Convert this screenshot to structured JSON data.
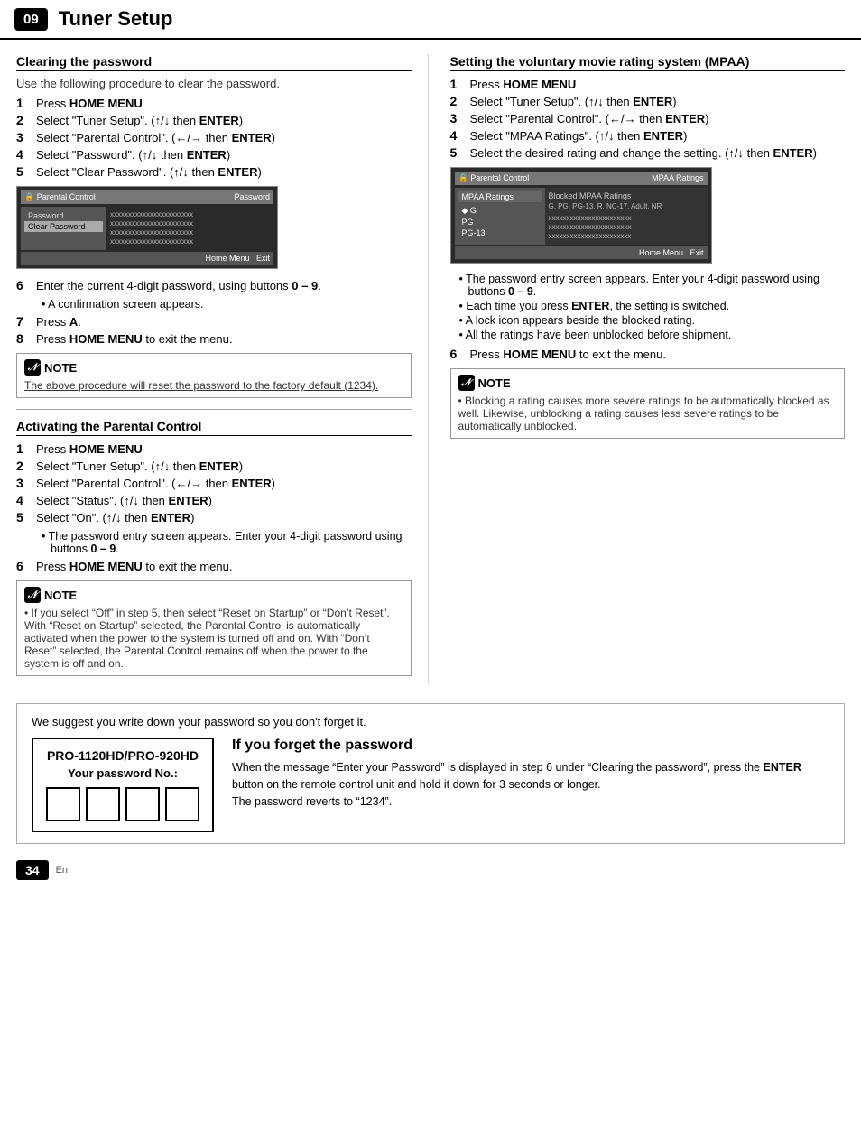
{
  "header": {
    "chapter": "09",
    "title": "Tuner Setup"
  },
  "left_column": {
    "section1": {
      "title": "Clearing the password",
      "subtitle": "Use the following procedure to clear the password.",
      "steps": [
        {
          "num": "1",
          "text": "Press ",
          "bold": "HOME MENU",
          "after": ""
        },
        {
          "num": "2",
          "text": "Select “Tuner Setup”. (",
          "arrow": "↑/↓",
          "then": " then ",
          "bold2": "ENTER",
          "after": ")"
        },
        {
          "num": "3",
          "text": "Select “Parental Control”. (",
          "arrow": "←/→",
          "then": " then ",
          "bold2": "ENTER",
          "after": ")"
        },
        {
          "num": "4",
          "text": "Select “Password”. (",
          "arrow": "↑/↓",
          "then": " then ",
          "bold2": "ENTER",
          "after": ")"
        },
        {
          "num": "5",
          "text": "Select “Clear Password”. (",
          "arrow": "↑/↓",
          "then": " then ",
          "bold2": "ENTER",
          "after": ")"
        }
      ],
      "screen_labels": {
        "title_left": "Parental Control",
        "title_right": "Password",
        "menu_items": [
          "Password",
          "Clear Password"
        ],
        "selected_item": "Clear Password",
        "content_lines": [
          "xxxxxxxxxxxxxxxxxxxxxxx",
          "xxxxxxxxxxxxxxxxxxxxxxx",
          "xxxxxxxxxxxxxxxxxxxxxxx",
          "xxxxxxxxxxxxxxxxxxxxxxx"
        ],
        "footer": "Home Menu  Exit"
      },
      "steps2": [
        {
          "num": "6",
          "text": "Enter the current 4-digit password, using buttons ",
          "bold": "0 – 9",
          "after": "."
        },
        {
          "bullet": "• A confirmation screen appears."
        },
        {
          "num": "7",
          "text": "Press ",
          "bold": "A",
          "after": "."
        },
        {
          "num": "8",
          "text": "Press ",
          "bold": "HOME MENU",
          "after": " to exit the menu."
        }
      ],
      "note": {
        "label": "NOTE",
        "text": "The above procedure will reset the password to the factory default (1234).",
        "underline": true
      }
    },
    "section2": {
      "title": "Activating the Parental Control",
      "steps": [
        {
          "num": "1",
          "text": "Press ",
          "bold": "HOME MENU",
          "after": ""
        },
        {
          "num": "2",
          "text": "Select “Tuner Setup”. (",
          "arrow": "↑/↓",
          "then": " then ",
          "bold2": "ENTER",
          "after": ")"
        },
        {
          "num": "3",
          "text": "Select “Parental Control”. (",
          "arrow": "←/→",
          "then": " then ",
          "bold2": "ENTER",
          "after": ")"
        },
        {
          "num": "4",
          "text": "Select “Status”. (",
          "arrow": "↑/↓",
          "then": " then ",
          "bold2": "ENTER",
          "after": ")"
        },
        {
          "num": "5",
          "text": "Select “On”. (",
          "arrow": "↑/↓",
          "then": " then ",
          "bold2": "ENTER",
          "after": ")"
        }
      ],
      "bullet5": "The password entry screen appears. Enter your 4-digit password using buttons ",
      "bullet5_bold": "0 – 9",
      "bullet5_after": ".",
      "step6": {
        "num": "6",
        "text": "Press ",
        "bold": "HOME MENU",
        "after": " to exit the menu."
      },
      "note": {
        "label": "NOTE",
        "text": "If you select “Off” in step 5, then select “Reset on Startup” or “Don’t Reset”. With “Reset on Startup” selected, the Parental Control is automatically activated when the power to the system is turned off and on. With “Don’t Reset” selected, the Parental Control remains off when the power to the system is off and on."
      }
    }
  },
  "right_column": {
    "section1": {
      "title": "Setting the voluntary movie rating system (MPAA)",
      "steps": [
        {
          "num": "1",
          "text": "Press ",
          "bold": "HOME MENU",
          "after": ""
        },
        {
          "num": "2",
          "text": "Select “Tuner Setup”. (",
          "arrow": "↑/↓",
          "then": " then ",
          "bold2": "ENTER",
          "after": ")"
        },
        {
          "num": "3",
          "text": "Select “Parental Control”. (",
          "arrow": "←/→",
          "then": " then ",
          "bold2": "ENTER",
          "after": ")"
        },
        {
          "num": "4",
          "text": "Select “MPAA Ratings”. (",
          "arrow": "↑/↓",
          "then": " then ",
          "bold2": "ENTER",
          "after": ")"
        },
        {
          "num": "5",
          "text": "Select the desired rating and change the setting. (",
          "arrow": "↑/↓",
          "after": " then ",
          "bold2": "ENTER",
          "close": ")"
        }
      ],
      "screen_labels": {
        "title_left": "Parental Control",
        "title_right": "MPAA Ratings",
        "left_items": [
          "MPAA Ratings"
        ],
        "right_items": [
          "G",
          "PG",
          "PG-13"
        ],
        "blocked_title": "Blocked MPAA Ratings",
        "blocked_list": "G, PG, PG-13, R, NC-17, Adult, NR",
        "content_lines": [
          "xxxxxxxxxxxxxxxxxxxxxxx",
          "xxxxxxxxxxxxxxxxxxxxxxx",
          "xxxxxxxxxxxxxxxxxxxxxxx"
        ],
        "footer": "Home Menu  Exit"
      },
      "bullets_after_screen": [
        "The password entry screen appears. Enter your 4-digit password using buttons ",
        "Each time you press ENTER, the setting is switched.",
        "A lock icon appears beside the blocked rating.",
        "All the ratings have been unblocked before shipment."
      ],
      "bullets_bold": [
        "0 – 9",
        "ENTER"
      ],
      "step6": {
        "num": "6",
        "text": "Press ",
        "bold": "HOME MENU",
        "after": " to exit the menu."
      },
      "note": {
        "label": "NOTE",
        "text": "Blocking a rating causes more severe ratings to be automatically blocked as well. Likewise, unblocking a rating causes less severe ratings to be automatically unblocked."
      }
    }
  },
  "bottom_box": {
    "tip": "We suggest you write down your password so you don't forget it.",
    "model_name": "PRO-1120HD/PRO-920HD",
    "password_label": "Your password No.:",
    "forget_title": "If you forget the password",
    "forget_text1": "When the message “Enter your Password” is displayed in step 6 under “Clearing the password”, press the ",
    "forget_bold": "ENTER",
    "forget_text2": " button on the remote control unit and hold it down for 3 seconds or longer.",
    "forget_text3": "The password reverts to “1234”."
  },
  "footer": {
    "page_number": "34",
    "lang": "En"
  }
}
